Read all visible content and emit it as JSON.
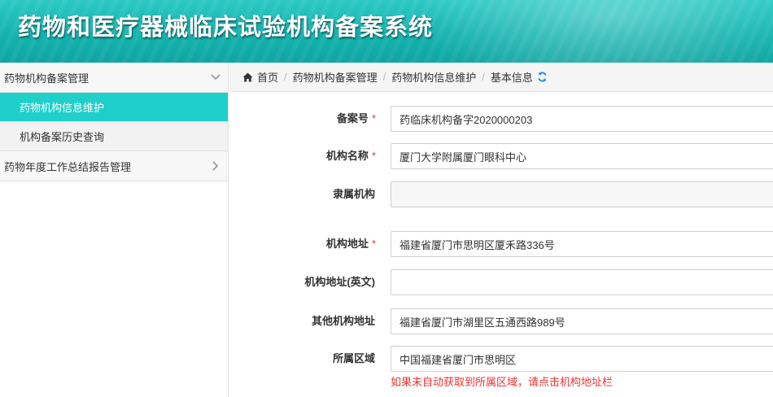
{
  "header": {
    "title": "药物和医疗器械临床试验机构备案系统"
  },
  "sidebar": {
    "groups": [
      {
        "label": "药物机构备案管理",
        "items": [
          {
            "label": "药物机构信息维护"
          },
          {
            "label": "机构备案历史查询"
          }
        ]
      },
      {
        "label": "药物年度工作总结报告管理"
      }
    ]
  },
  "breadcrumb": {
    "items": [
      "首页",
      "药物机构备案管理",
      "药物机构信息维护",
      "基本信息"
    ],
    "separator": "/"
  },
  "form": {
    "required_mark": "*",
    "fields": [
      {
        "label": "备案号",
        "value": "药临床机构备字2020000203"
      },
      {
        "label": "机构名称",
        "value": "厦门大学附属厦门眼科中心"
      },
      {
        "label": "隶属机构",
        "value": ""
      },
      {
        "label": "机构地址",
        "value": "福建省厦门市思明区厦禾路336号"
      },
      {
        "label": "机构地址(英文)",
        "value": ""
      },
      {
        "label": "其他机构地址",
        "value": "福建省厦门市湖里区五通西路989号"
      },
      {
        "label": "所属区域",
        "value": "中国福建省厦门市思明区"
      }
    ],
    "region_hint": "如果未自动获取到所属区域，请点击机构地址栏"
  },
  "colors": {
    "accent": "#1fcfca",
    "header": "#13b3af",
    "required": "#e33333",
    "refresh_icon": "#1a8fd6"
  },
  "icons": {
    "home": "home-icon",
    "refresh": "refresh-icon",
    "chevron_down": "chevron-down-icon",
    "chevron_right": "chevron-right-icon"
  }
}
